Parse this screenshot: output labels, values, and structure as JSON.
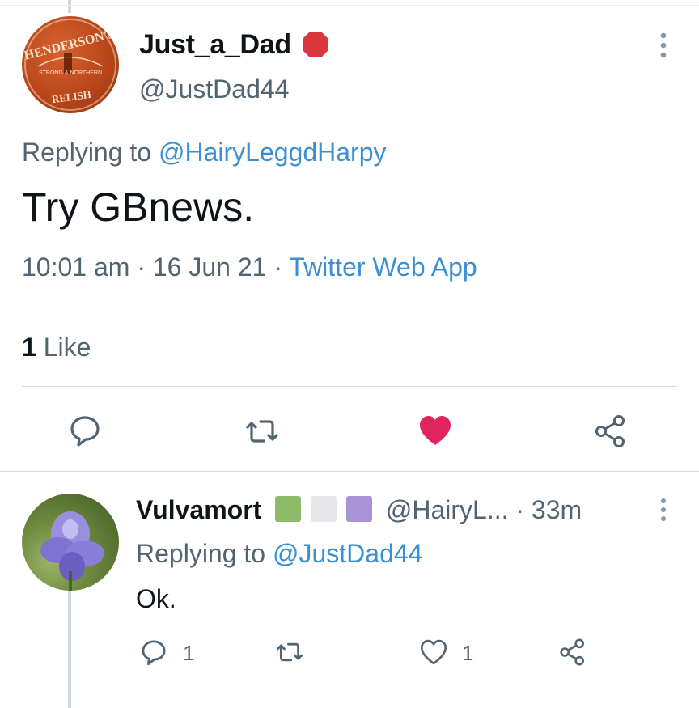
{
  "tweet": {
    "author_name": "Just_a_Dad",
    "author_handle": "@JustDad44",
    "replying_prefix": "Replying to",
    "replying_to": "@HairyLeggdHarpy",
    "text": "Try GBnews.",
    "time": "10:01 am",
    "date": "16 Jun 21",
    "source": "Twitter Web App",
    "like_count": "1",
    "like_label": "Like",
    "avatar_text_top": "HENDERSON'S",
    "avatar_text_bottom": "RELISH",
    "avatar_text_mid": "STRONG & NORTHERN",
    "colors": {
      "like_active": "#e0245e",
      "link": "#3a8fd5"
    }
  },
  "reply": {
    "author_name": "Vulvamort",
    "flag_colors": [
      "#8dbb6a",
      "#e8e8ea",
      "#a993d6"
    ],
    "author_handle": "@HairyL...",
    "time": "33m",
    "replying_prefix": "Replying to",
    "replying_to": "@JustDad44",
    "text": "Ok.",
    "reply_count": "1",
    "like_count": "1"
  }
}
